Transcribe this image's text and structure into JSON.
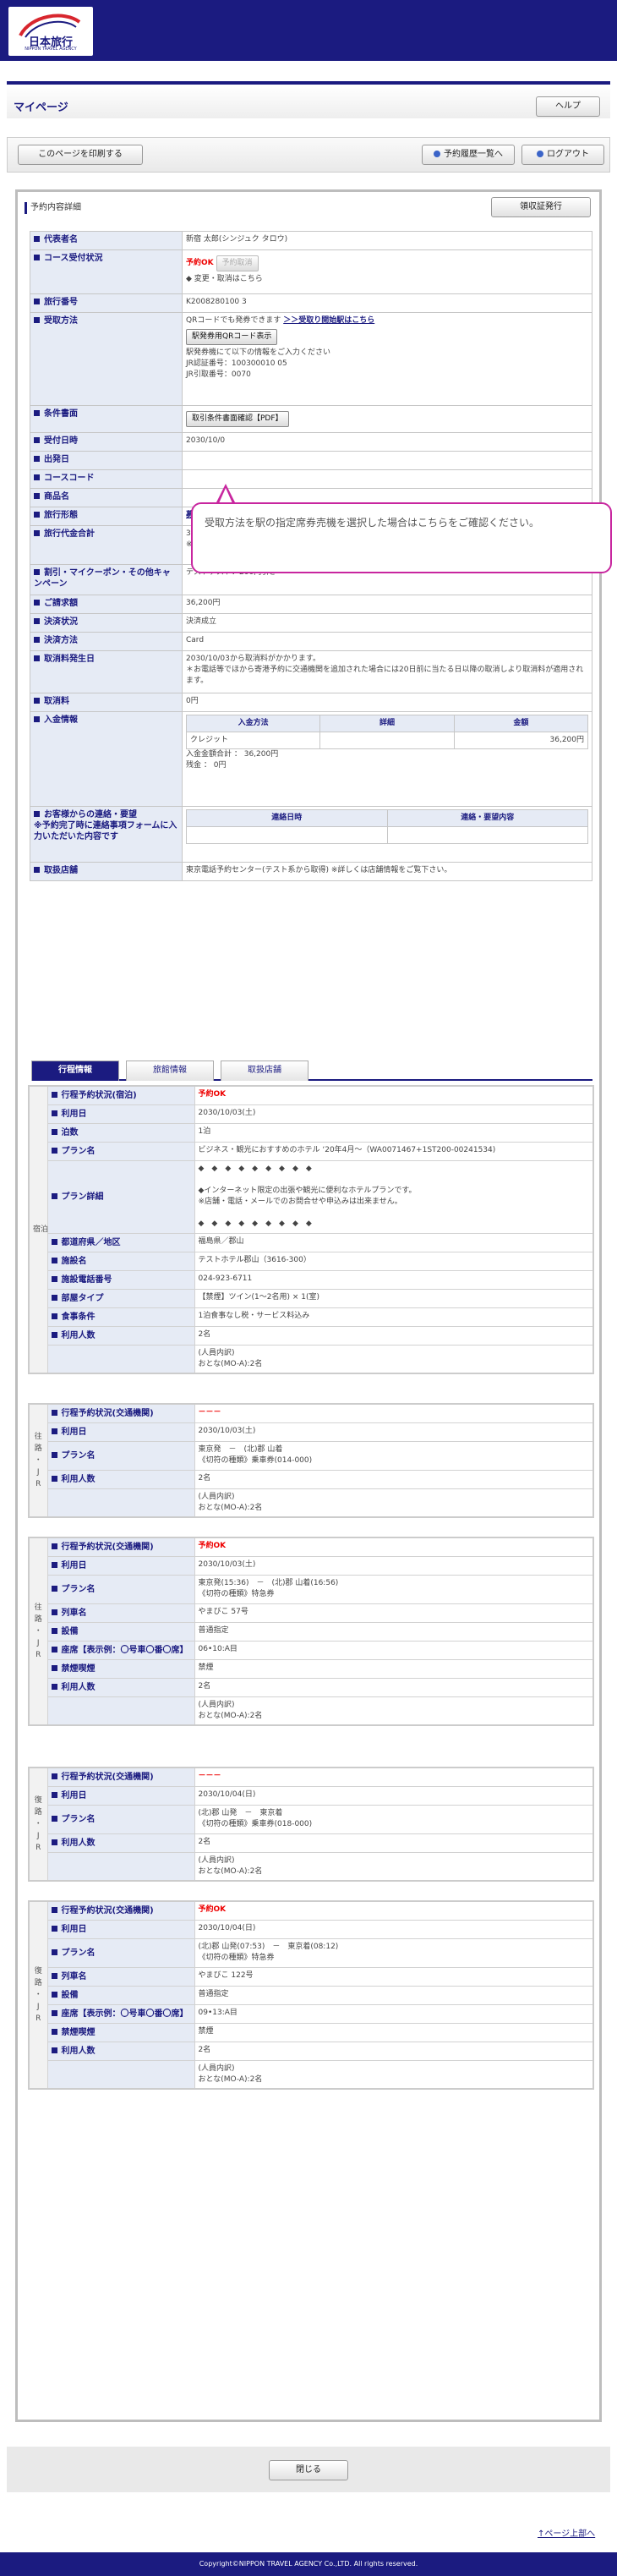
{
  "header": {
    "logo_text": "日本旅行",
    "logo_sub": "NIPPON TRAVEL AGENCY"
  },
  "page": {
    "title": "マイページ",
    "help": "ヘルプ"
  },
  "toolbar": {
    "print": "このページを印刷する",
    "history": "予約履歴一覧へ",
    "logout": "ログアウト"
  },
  "section": {
    "title": "予約内容詳細",
    "voucher": "領収証発行"
  },
  "details": [
    {
      "label": "代表者名",
      "value": "新宿 太郎(シンジュク タロウ)"
    },
    {
      "label": "コース受付状況",
      "status": "予約OK",
      "cancel_btn": "予約取消",
      "note": "◆ 変更・取消はこちら"
    },
    {
      "label": "旅行番号",
      "value": "K2008280100 3"
    },
    {
      "label": "受取方法",
      "lines": [
        "QRコードでも発券できます"
      ],
      "link": "＞＞受取り開始駅はこちら",
      "qr_btn": "駅発券用QRコード表示",
      "after": [
        "駅発券機にて以下の情報をご入力ください",
        "JR認証番号：100300010 05",
        "JR引取番号：0070"
      ]
    },
    {
      "label": "条件書面",
      "btn": "取引条件書面確認【PDF】"
    },
    {
      "label": "受付日時",
      "value": "2030/10/0"
    },
    {
      "label": "出発日",
      "value": ""
    },
    {
      "label": "コースコード",
      "value": ""
    },
    {
      "label": "商品名",
      "value": ""
    },
    {
      "label": "旅行形態",
      "link": "募集型企画旅行"
    },
    {
      "label": "旅行代金合計",
      "value": "36,400円",
      "note": "※予約確定後、日程変更、参加人員の変更、フライト変更などにより発生した取消料は含まれておりません。"
    },
    {
      "label": "割引・マイクーポン・その他キャンペーン",
      "value": "テストテスト：200円引き"
    },
    {
      "label": "ご請求額",
      "value": "36,200円"
    },
    {
      "label": "決済状況",
      "value": "決済成立"
    },
    {
      "label": "決済方法",
      "value": "Card"
    },
    {
      "label": "取消料発生日",
      "value": "2030/10/03から取消料がかかります。",
      "note": "＊お電話等でほから寄港予約に交通機関を追加された場合には20日前に当たる日以降の取消しより取消料が適用されます。"
    },
    {
      "label": "取消料",
      "value": "0円"
    }
  ],
  "payment": {
    "label": "入金情報",
    "headers": [
      "入金方法",
      "詳細",
      "金額"
    ],
    "row": [
      "クレジット",
      "",
      "36,200円"
    ],
    "total": "入金金額合計 ： 36,200円",
    "balance": "残金 ： 0円"
  },
  "contact": {
    "label": "お客様からの連絡・要望\n※予約完了時に連絡事項フォームに入力いただいた内容です",
    "headers": [
      "連絡日時",
      "連絡・要望内容"
    ]
  },
  "store": {
    "label": "取扱店舗",
    "value": "東京電話予約センター(テスト系から取得) ※詳しくは店舗情報をご覧下さい。"
  },
  "tabs": [
    "行程情報",
    "旅館情報",
    "取扱店舗"
  ],
  "lodging": {
    "cat": "宿泊",
    "rows": [
      {
        "label": "行程予約状況(宿泊)",
        "value": "予約OK",
        "red": true
      },
      {
        "label": "利用日",
        "value": "2030/10/03(土)"
      },
      {
        "label": "泊数",
        "value": "1泊"
      },
      {
        "label": "プラン名",
        "value": "ビジネス・観光におすすめのホテル ‘20年4月〜（WA0071467+1ST200-00241534)"
      },
      {
        "label": "プラン詳細",
        "lines": [
          "◆　◆　◆　◆　◆　◆　◆　◆　◆",
          "",
          "◆インターネット限定の出張や観光に便利なホテルプランです。",
          "※店舗・電話・メールでのお問合せや申込みは出来ません。",
          "",
          "◆　◆　◆　◆　◆　◆　◆　◆　◆"
        ]
      },
      {
        "label": "都道府県／地区",
        "value": "福島県／郡山"
      },
      {
        "label": "施設名",
        "value": "テストホテル郡山（3616-300）"
      },
      {
        "label": "施設電話番号",
        "value": "024-923-6711"
      },
      {
        "label": "部屋タイプ",
        "value": "【禁煙】ツイン(1〜2名用) × 1(室)"
      },
      {
        "label": "食事条件",
        "value": "1泊食事なし税・サービス料込み"
      },
      {
        "label": "利用人数",
        "value": "2名"
      },
      {
        "label": "",
        "lines": [
          "(人員内訳)",
          "おとな(MO-A):2名"
        ]
      }
    ]
  },
  "jr_out_1": {
    "cat": "往\n路\n・\nJ\nR",
    "rows": [
      {
        "label": "行程予約状況(交通機関)",
        "value": "－－－",
        "red": true
      },
      {
        "label": "利用日",
        "value": "2030/10/03(土)"
      },
      {
        "label": "プラン名",
        "lines": [
          "東京発　－　(北)郡 山着",
          "《切符の種類》乗車券(014-000)"
        ]
      },
      {
        "label": "利用人数",
        "value": "2名"
      },
      {
        "label": "",
        "lines": [
          "(人員内訳)",
          "おとな(MO-A):2名"
        ]
      }
    ]
  },
  "jr_out_2": {
    "cat": "往\n路\n・\nJ\nR",
    "rows": [
      {
        "label": "行程予約状況(交通機関)",
        "value": "予約OK",
        "red": true
      },
      {
        "label": "利用日",
        "value": "2030/10/03(土)"
      },
      {
        "label": "プラン名",
        "lines": [
          "東京発(15:36)　－　(北)郡 山着(16:56)",
          "《切符の種類》特急券"
        ]
      },
      {
        "label": "列車名",
        "value": "やまびこ 57号"
      },
      {
        "label": "設備",
        "value": "普通指定"
      },
      {
        "label": "座席【表示例：〇号車〇番〇席】",
        "value": "06•10:A目"
      },
      {
        "label": "禁煙喫煙",
        "value": "禁煙"
      },
      {
        "label": "利用人数",
        "value": "2名"
      },
      {
        "label": "",
        "lines": [
          "(人員内訳)",
          "おとな(MO-A):2名"
        ]
      }
    ]
  },
  "jr_ret_1": {
    "cat": "復\n路\n・\nJ\nR",
    "rows": [
      {
        "label": "行程予約状況(交通機関)",
        "value": "－－－",
        "red": true
      },
      {
        "label": "利用日",
        "value": "2030/10/04(日)"
      },
      {
        "label": "プラン名",
        "lines": [
          "(北)郡 山発　－　東京着",
          "《切符の種類》乗車券(018-000)"
        ]
      },
      {
        "label": "利用人数",
        "value": "2名"
      },
      {
        "label": "",
        "lines": [
          "(人員内訳)",
          "おとな(MO-A):2名"
        ]
      }
    ]
  },
  "jr_ret_2": {
    "cat": "復\n路\n・\nJ\nR",
    "rows": [
      {
        "label": "行程予約状況(交通機関)",
        "value": "予約OK",
        "red": true
      },
      {
        "label": "利用日",
        "value": "2030/10/04(日)"
      },
      {
        "label": "プラン名",
        "lines": [
          "(北)郡 山発(07:53)　－　東京着(08:12)",
          "《切符の種類》特急券"
        ]
      },
      {
        "label": "列車名",
        "value": "やまびこ 122号"
      },
      {
        "label": "設備",
        "value": "普通指定"
      },
      {
        "label": "座席【表示例：〇号車〇番〇席】",
        "value": "09•13:A目"
      },
      {
        "label": "禁煙喫煙",
        "value": "禁煙"
      },
      {
        "label": "利用人数",
        "value": "2名"
      },
      {
        "label": "",
        "lines": [
          "(人員内訳)",
          "おとな(MO-A):2名"
        ]
      }
    ]
  },
  "tip": "受取方法を駅の指定席券売機を選択した場合はこちらをご確認ください。",
  "footer": {
    "close": "閉じる",
    "pagetop": "↑ページ上部へ",
    "copyright": "Copyright©NIPPON TRAVEL AGENCY Co.,LTD. All rights reserved."
  },
  "colors": {
    "navy": "#1b1b80",
    "accent_red": "#e00000",
    "tip_border": "#c8269f"
  }
}
